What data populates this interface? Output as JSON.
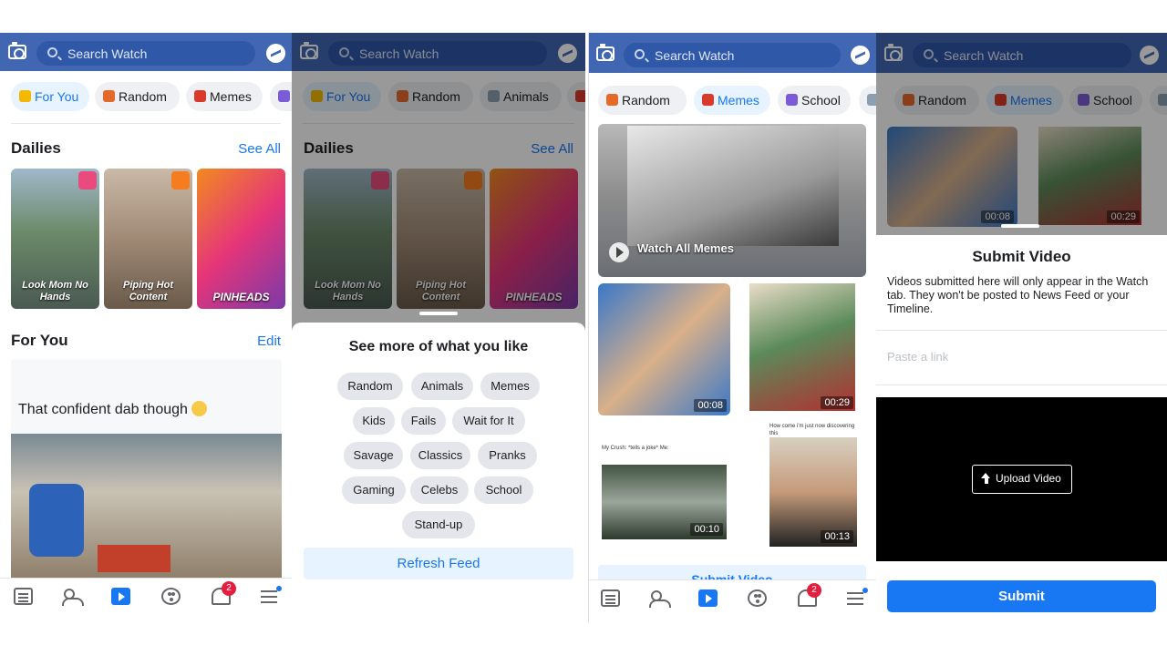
{
  "app": {
    "search_placeholder": "Search Watch",
    "brand_color": "#4267b2",
    "accent_color": "#1877f2"
  },
  "panel1": {
    "chips": [
      "For You",
      "Random",
      "Memes"
    ],
    "dailies_title": "Dailies",
    "see_all": "See All",
    "cards": [
      "Look Mom No Hands",
      "Piping Hot Content",
      "PINHEADS"
    ],
    "for_you_title": "For You",
    "edit": "Edit",
    "post_text": "That confident dab though",
    "notification_count": "2"
  },
  "panel2": {
    "chips": [
      "For You",
      "Random",
      "Animals"
    ],
    "dailies_title": "Dailies",
    "see_all": "See All",
    "cards": [
      "Look Mom No Hands",
      "Piping Hot Content",
      "PINHEADS"
    ],
    "sheet_title": "See more of what you like",
    "topics": [
      "Random",
      "Animals",
      "Memes",
      "Kids",
      "Fails",
      "Wait for It",
      "Savage",
      "Classics",
      "Pranks",
      "Gaming",
      "Celebs",
      "School",
      "Stand-up"
    ],
    "refresh_label": "Refresh Feed"
  },
  "panel3": {
    "chips": [
      "Random",
      "Memes",
      "School"
    ],
    "watch_all": "Watch All Memes",
    "durations": [
      "00:08",
      "00:29",
      "00:10",
      "00:13"
    ],
    "meme_caption_1": "My Crush: *tells a joke* Me:",
    "meme_caption_2": "How come i'm just now discovering this",
    "submit_partial": "Submit Video",
    "notification_count": "2"
  },
  "panel4": {
    "chips": [
      "Random",
      "Memes",
      "School"
    ],
    "durations": [
      "00:08",
      "00:29"
    ],
    "title": "Submit Video",
    "description": "Videos submitted here will only appear in the Watch tab. They won't be posted to News Feed or your Timeline.",
    "paste_placeholder": "Paste a link",
    "upload_label": "Upload Video",
    "submit_label": "Submit"
  }
}
